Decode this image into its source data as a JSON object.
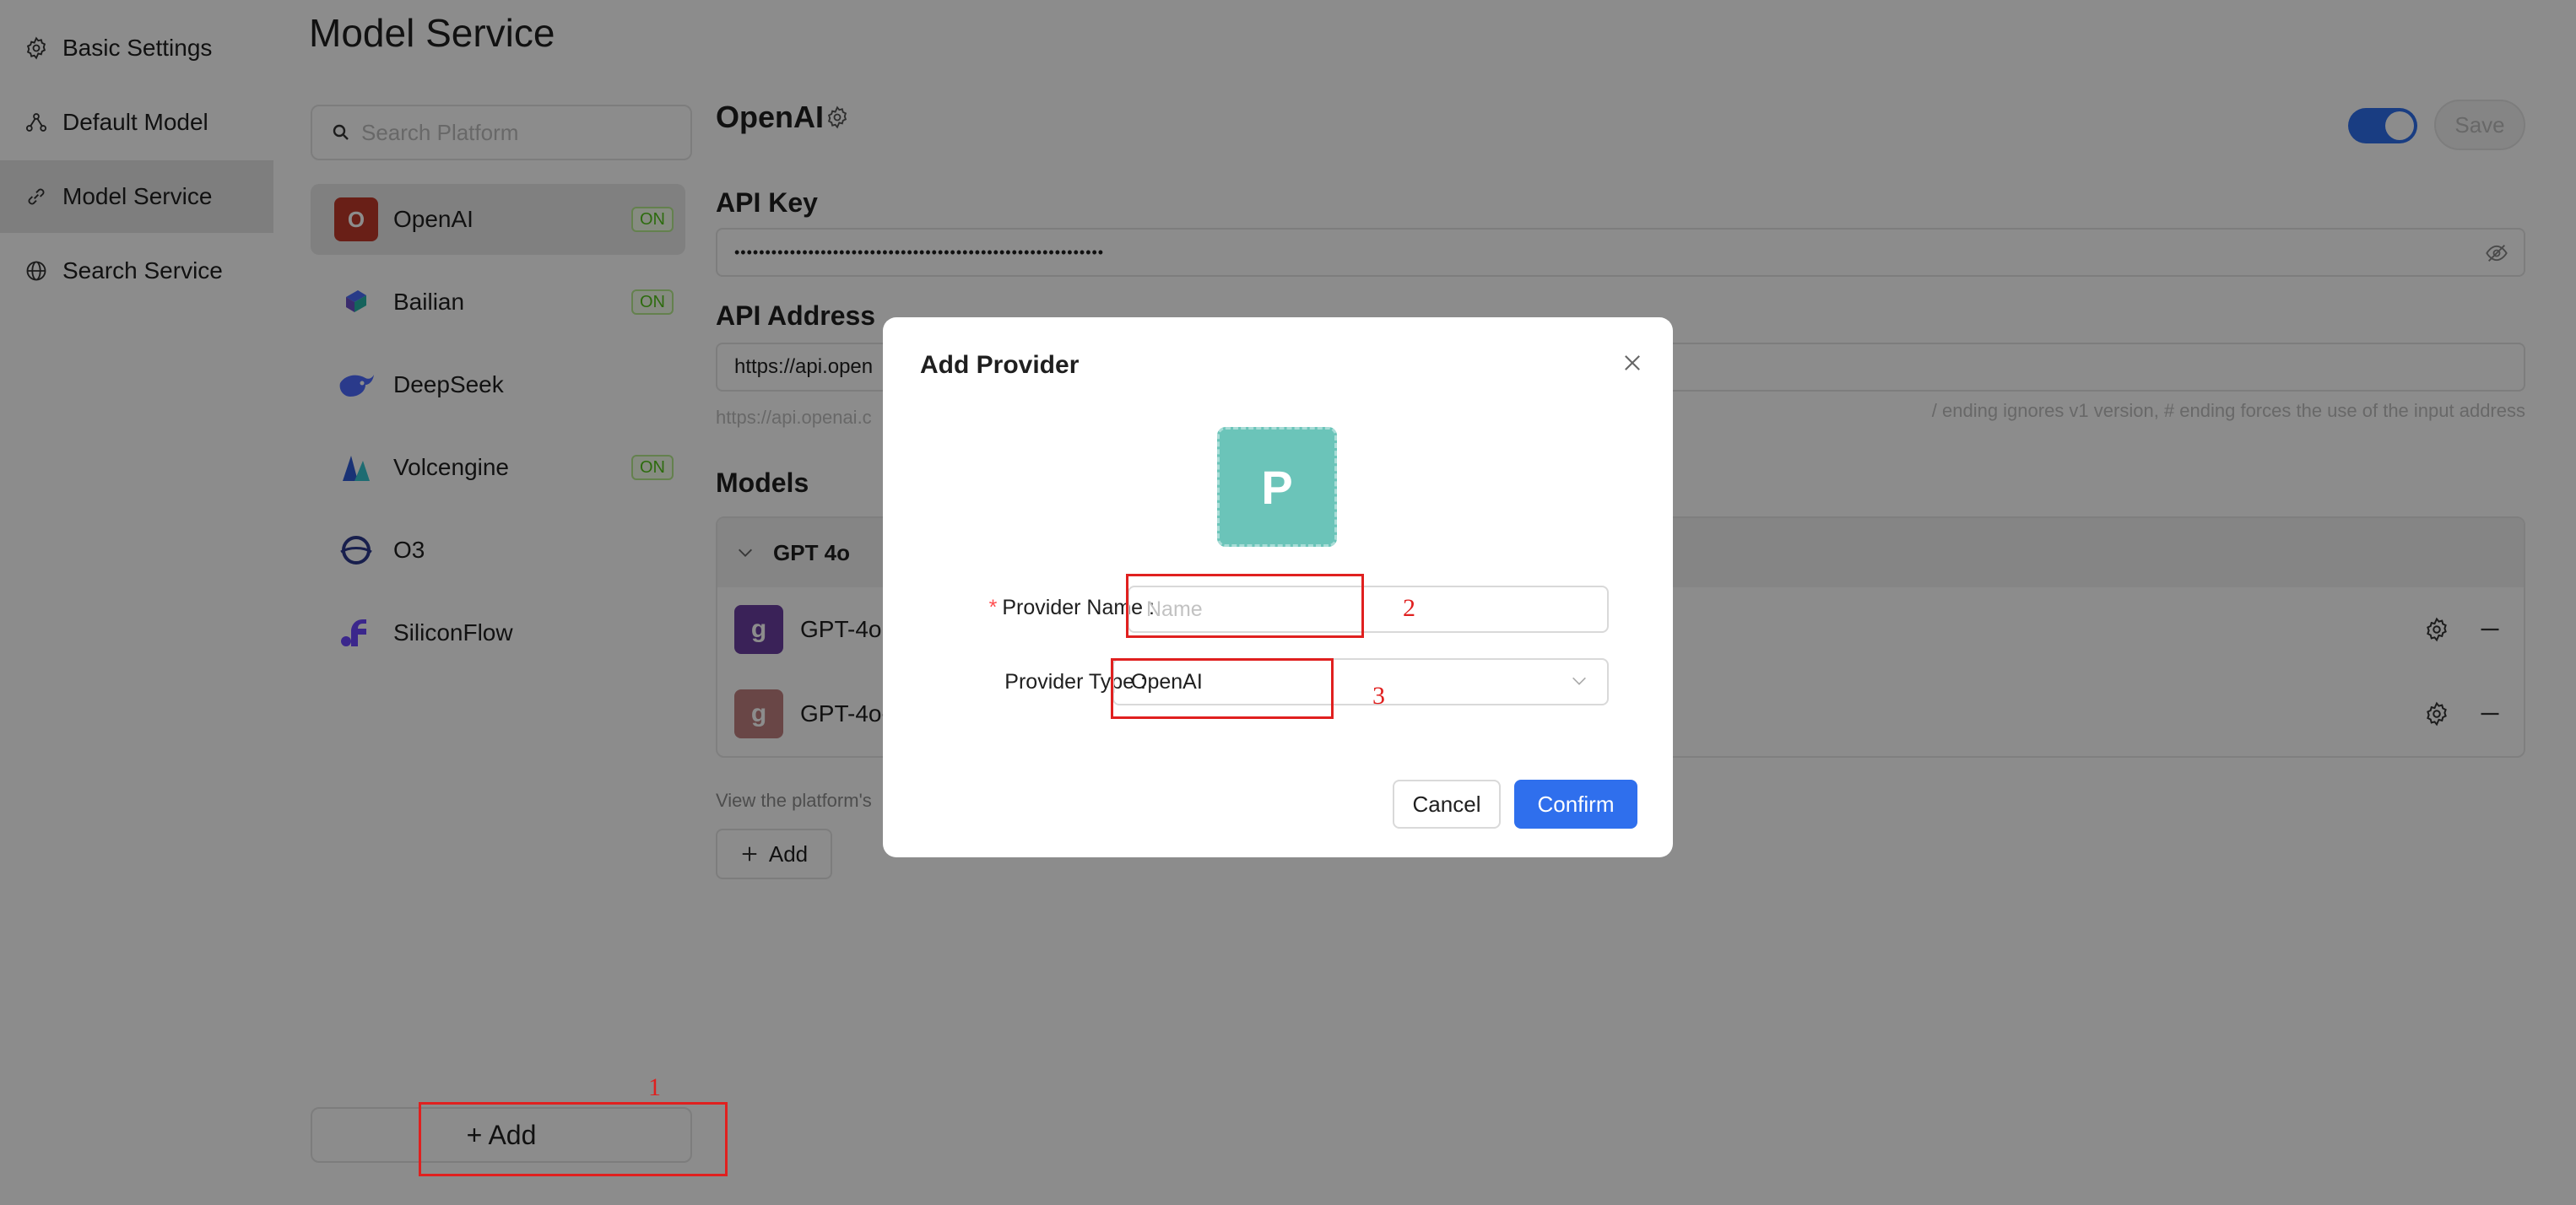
{
  "nav": {
    "items": [
      {
        "label": "Basic Settings",
        "icon": "gear-icon"
      },
      {
        "label": "Default Model",
        "icon": "network-icon"
      },
      {
        "label": "Model Service",
        "icon": "link-icon"
      },
      {
        "label": "Search Service",
        "icon": "globe-icon"
      }
    ],
    "active_index": 2
  },
  "page_title": "Model Service",
  "search": {
    "placeholder": "Search Platform"
  },
  "providers": [
    {
      "name": "OpenAI",
      "logo": "O",
      "logo_color": "#c0392b",
      "badge": "ON"
    },
    {
      "name": "Bailian",
      "logo": "bailian-icon",
      "badge": "ON"
    },
    {
      "name": "DeepSeek",
      "logo": "deepseek-icon"
    },
    {
      "name": "Volcengine",
      "logo": "volcengine-icon",
      "badge": "ON"
    },
    {
      "name": "O3",
      "logo": "o3-icon"
    },
    {
      "name": "SiliconFlow",
      "logo": "siliconflow-icon"
    }
  ],
  "add_provider_label": "+ Add",
  "main": {
    "provider_title": "OpenAI",
    "save_label": "Save",
    "api_key_label": "API Key",
    "api_key_value": "••••••••••••••••••••••••••••••••••••••••••••••••••••••••••••",
    "api_address_label": "API Address",
    "api_address_value": "https://api.open",
    "api_address_hint_left": "https://api.openai.c",
    "api_address_hint_right": "/ ending ignores v1 version, # ending forces the use of the input address",
    "models_label": "Models",
    "model_group": "GPT 4o",
    "models": [
      {
        "name": "GPT-4o",
        "logo": "g",
        "color": "#6b3fa0"
      },
      {
        "name": "GPT-4o-",
        "logo": "g",
        "color": "#c08080"
      }
    ],
    "view_hint": "View the platform's",
    "add_model_label": "Add"
  },
  "modal": {
    "title": "Add Provider",
    "avatar_letter": "P",
    "name_label": "Provider Name",
    "name_placeholder": "Name",
    "type_label": "Provider Type",
    "type_value": "OpenAI",
    "cancel_label": "Cancel",
    "confirm_label": "Confirm"
  },
  "annotations": [
    "1",
    "2",
    "3"
  ]
}
